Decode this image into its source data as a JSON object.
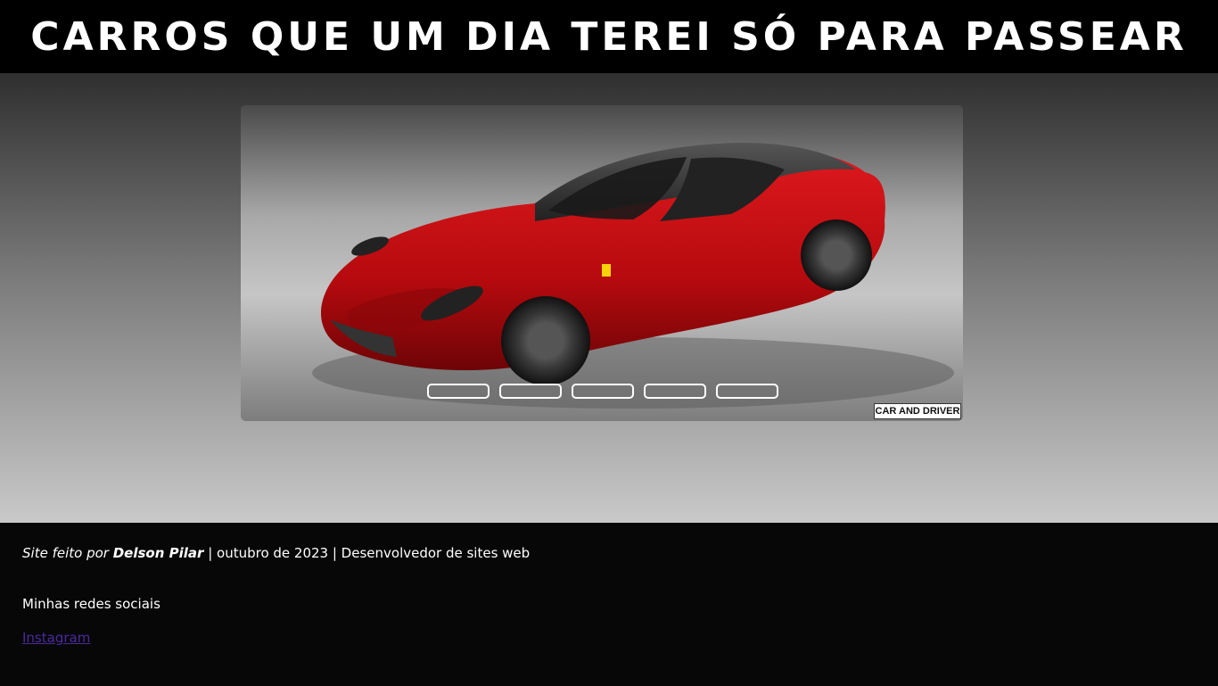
{
  "header": {
    "title": "Carros que um dia terei só para passear"
  },
  "slider": {
    "image_alt": "Ferrari vermelha",
    "watermark": "CAR AND DRIVER",
    "dots": [
      {
        "label": ""
      },
      {
        "label": ""
      },
      {
        "label": ""
      },
      {
        "label": ""
      },
      {
        "label": ""
      }
    ]
  },
  "footer": {
    "credit_prefix": "Site feito por",
    "author": "Delson Pilar",
    "credit_suffix": "| outubro de 2023 | Desenvolvedor de sites web",
    "social_title": "Minhas redes sociais",
    "instagram_label": "Instagram"
  },
  "colors": {
    "header_bg": "#000000",
    "footer_bg": "#070707",
    "link": "#4c2a9c",
    "car_red": "#c80c10"
  }
}
